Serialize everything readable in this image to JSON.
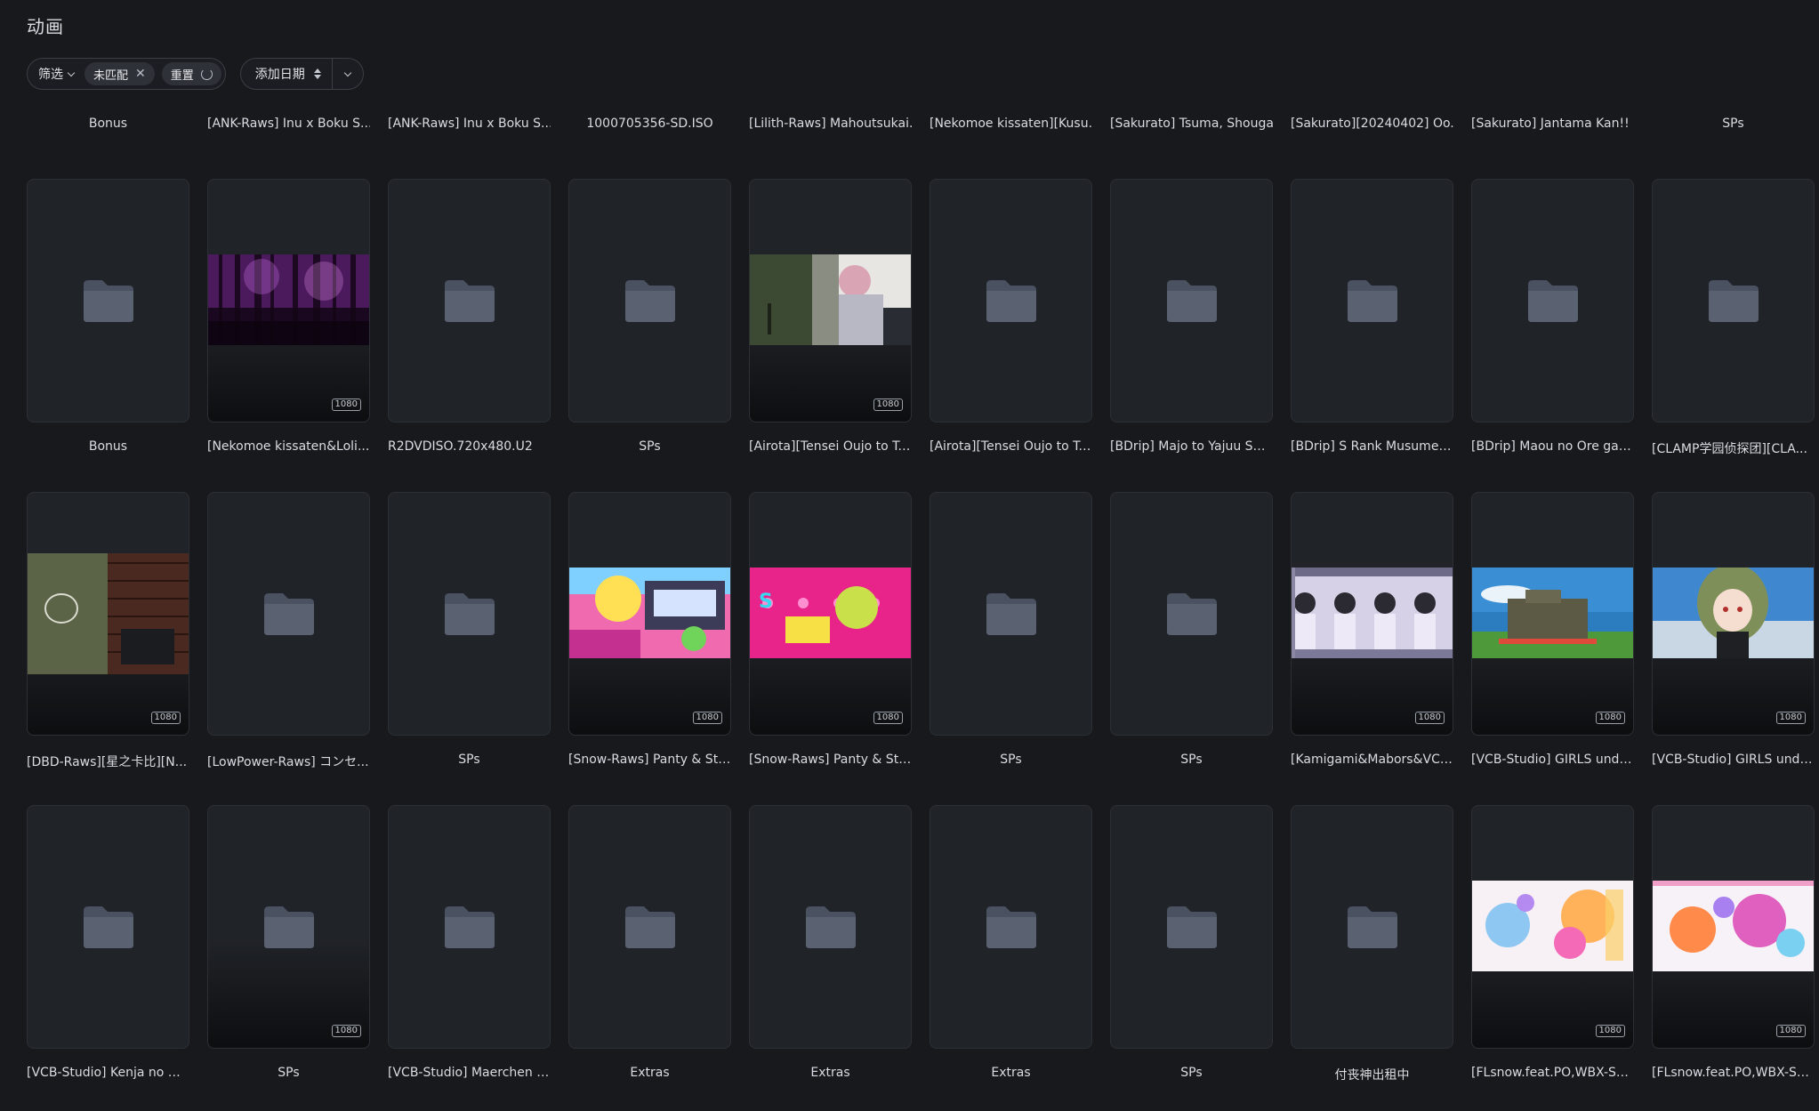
{
  "page": {
    "title": "动画"
  },
  "toolbar": {
    "filter_label": "筛选",
    "chip_unmatched": "未匹配",
    "chip_reset": "重置",
    "sort_label": "添加日期"
  },
  "top_row": [
    {
      "title": "Bonus",
      "align": "center"
    },
    {
      "title": "[ANK-Raws] Inu x Boku S...",
      "align": "left"
    },
    {
      "title": "[ANK-Raws] Inu x Boku S...",
      "align": "left"
    },
    {
      "title": "1000705356-SD.ISO",
      "align": "center"
    },
    {
      "title": "[Lilith-Raws] Mahoutsukai...",
      "align": "left"
    },
    {
      "title": "[Nekomoe kissaten][Kusu...",
      "align": "left"
    },
    {
      "title": "[Sakurato] Tsuma, Shouga...",
      "align": "left"
    },
    {
      "title": "[Sakurato][20240402] Oo...",
      "align": "left"
    },
    {
      "title": "[Sakurato] Jantama Kan!! ...",
      "align": "left"
    },
    {
      "title": "SPs",
      "align": "center"
    }
  ],
  "rows": [
    [
      {
        "title": "Bonus",
        "type": "folder",
        "align": "center"
      },
      {
        "title": "[Nekomoe kissaten&Loli...",
        "type": "thumb",
        "thumb": "forest",
        "badge": "1080",
        "align": "left"
      },
      {
        "title": "R2DVDISO.720x480.U2",
        "type": "folder",
        "align": "left"
      },
      {
        "title": "SPs",
        "type": "folder",
        "align": "center"
      },
      {
        "title": "[Airota][Tensei Oujo to Te...",
        "type": "thumb",
        "thumb": "room",
        "badge": "1080",
        "align": "left"
      },
      {
        "title": "[Airota][Tensei Oujo to Te...",
        "type": "folder",
        "align": "left"
      },
      {
        "title": "[BDrip] Majo to Yajuu S01...",
        "type": "folder",
        "align": "left"
      },
      {
        "title": "[BDrip] S Rank Musume S...",
        "type": "folder",
        "align": "left"
      },
      {
        "title": "[BDrip] Maou no Ore ga ...",
        "type": "folder",
        "align": "left"
      },
      {
        "title": "[CLAMP学园侦探团][CLA...",
        "type": "folder",
        "align": "left"
      }
    ],
    [
      {
        "title": "[DBD-Raws][星之卡比][N...",
        "type": "thumb",
        "thumb": "wall",
        "badge": "1080",
        "align": "left",
        "tall": true
      },
      {
        "title": "[LowPower-Raws] コンセ...",
        "type": "folder",
        "align": "left"
      },
      {
        "title": "SPs",
        "type": "folder",
        "align": "center"
      },
      {
        "title": "[Snow-Raws] Panty & Sto...",
        "type": "thumb",
        "thumb": "panty1",
        "badge": "1080",
        "align": "left"
      },
      {
        "title": "[Snow-Raws] Panty & Sto...",
        "type": "thumb",
        "thumb": "panty2",
        "badge": "1080",
        "align": "left"
      },
      {
        "title": "SPs",
        "type": "folder",
        "align": "center"
      },
      {
        "title": "SPs",
        "type": "folder",
        "align": "center"
      },
      {
        "title": "[Kamigami&Mabors&VCB...",
        "type": "thumb",
        "thumb": "class",
        "badge": "1080",
        "align": "left"
      },
      {
        "title": "[VCB-Studio] GIRLS und P...",
        "type": "thumb",
        "thumb": "tank",
        "badge": "1080",
        "align": "left"
      },
      {
        "title": "[VCB-Studio] GIRLS und P...",
        "type": "thumb",
        "thumb": "girl",
        "badge": "1080",
        "align": "left"
      }
    ],
    [
      {
        "title": "[VCB-Studio] Kenja no De...",
        "type": "folder",
        "align": "left"
      },
      {
        "title": "SPs",
        "type": "folder-badge",
        "badge": "1080",
        "align": "center"
      },
      {
        "title": "[VCB-Studio] Maerchen M...",
        "type": "folder",
        "align": "left"
      },
      {
        "title": "Extras",
        "type": "folder",
        "align": "center"
      },
      {
        "title": "Extras",
        "type": "folder",
        "align": "center"
      },
      {
        "title": "Extras",
        "type": "folder",
        "align": "center"
      },
      {
        "title": "SPs",
        "type": "folder",
        "align": "center"
      },
      {
        "title": "付丧神出租中",
        "type": "folder",
        "align": "center"
      },
      {
        "title": "[FLsnow.feat.PO,WBX-SU...",
        "type": "thumb",
        "thumb": "idol1",
        "badge": "1080",
        "align": "left"
      },
      {
        "title": "[FLsnow.feat.PO,WBX-SU...",
        "type": "thumb",
        "thumb": "idol2",
        "badge": "1080",
        "align": "left"
      }
    ]
  ]
}
